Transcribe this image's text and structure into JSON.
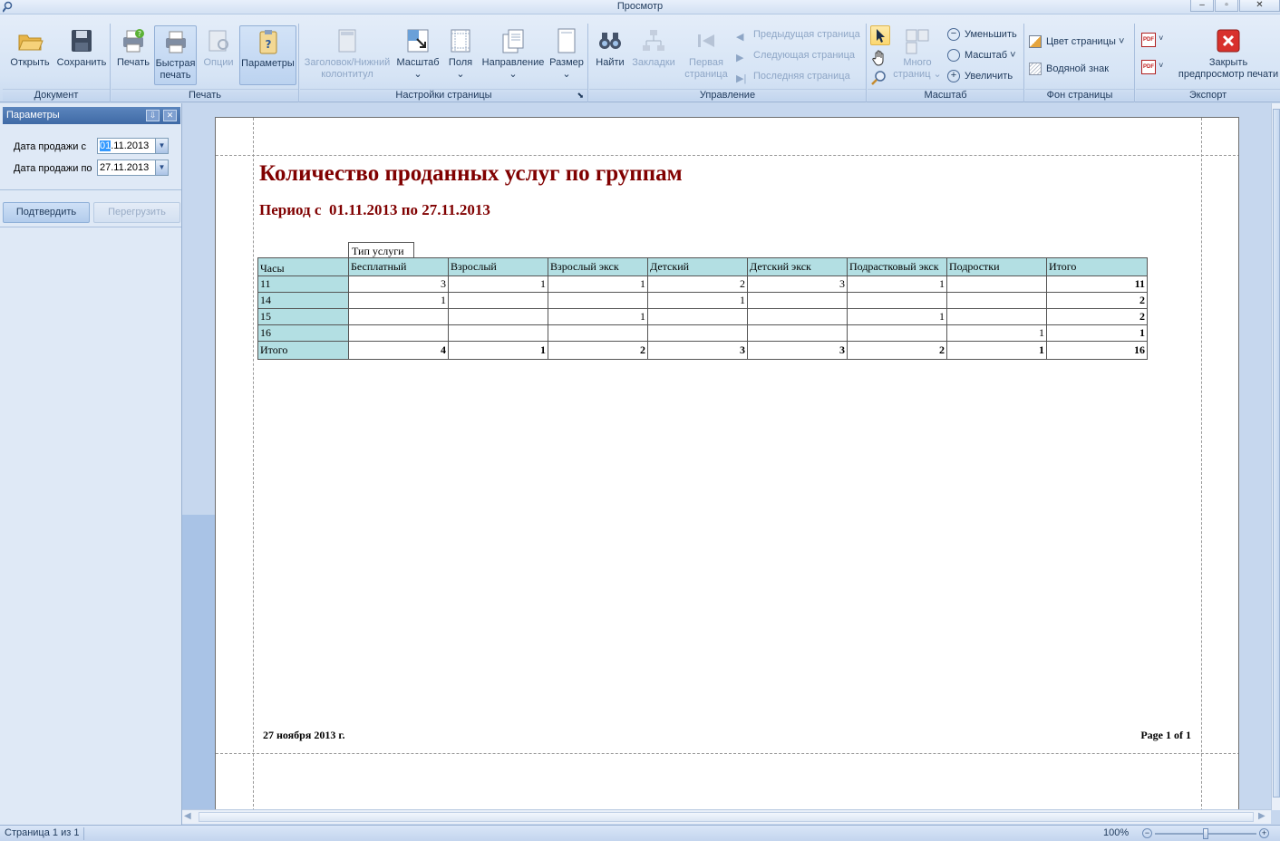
{
  "window": {
    "title": "Просмотр"
  },
  "ribbon": {
    "groups": {
      "document": "Документ",
      "print": "Печать",
      "page_settings": "Настройки страницы",
      "navigation": "Управление",
      "zoom": "Масштаб",
      "background": "Фон страницы",
      "export": "Экспорт"
    },
    "buttons": {
      "open": "Открыть",
      "save": "Сохранить",
      "print": "Печать",
      "quick_print_1": "Быстрая",
      "quick_print_2": "печать",
      "options": "Опции",
      "parameters": "Параметры",
      "header_footer_1": "Заголовок/Нижний",
      "header_footer_2": "колонтитул",
      "scale": "Масштаб",
      "margins": "Поля",
      "orientation": "Направление",
      "size": "Размер",
      "find": "Найти",
      "bookmarks": "Закладки",
      "first_page_1": "Первая",
      "first_page_2": "страница",
      "prev_page": "Предыдущая страница",
      "next_page": "Следующая страница",
      "last_page": "Последняя страница",
      "many_pages_1": "Много",
      "many_pages_2": "страниц",
      "zoom_out": "Уменьшить",
      "zoom": "Масштаб",
      "zoom_in": "Увеличить",
      "page_color": "Цвет страницы",
      "watermark": "Водяной знак",
      "close_1": "Закрыть",
      "close_2": "предпросмотр печати"
    },
    "icons": {
      "pdf": "PDF"
    }
  },
  "parameters_panel": {
    "title": "Параметры",
    "date_from_label": "Дата продажи с",
    "date_from_day": "01",
    "date_from_rest": ".11.2013",
    "date_to_label": "Дата продажи по",
    "date_to_value": "27.11.2013",
    "confirm": "Подтвердить",
    "reload": "Перегрузить"
  },
  "report": {
    "title": "Количество проданных услуг по группам",
    "period_prefix": "Период с",
    "period_from": "01.11.2013",
    "period_sep": "по",
    "period_to": "27.11.2013",
    "service_type_header": "Тип услуги",
    "row_header": "Часы",
    "columns": [
      "Бесплатный",
      "Взрослый",
      "Взрослый экск",
      "Детский",
      "Детский экск",
      "Подрастковый экск",
      "Подростки",
      "Итого"
    ],
    "rows": [
      {
        "hour": "11",
        "values": [
          "3",
          "1",
          "1",
          "2",
          "3",
          "1",
          "",
          "11"
        ]
      },
      {
        "hour": "14",
        "values": [
          "1",
          "",
          "",
          "1",
          "",
          "",
          "",
          "2"
        ]
      },
      {
        "hour": "15",
        "values": [
          "",
          "",
          "1",
          "",
          "",
          "1",
          "",
          "2"
        ]
      },
      {
        "hour": "16",
        "values": [
          "",
          "",
          "",
          "",
          "",
          "",
          "1",
          "1"
        ]
      }
    ],
    "total": {
      "label": "Итого",
      "values": [
        "4",
        "1",
        "2",
        "3",
        "3",
        "2",
        "1",
        "16"
      ]
    },
    "footer_date": "27 ноября 2013 г.",
    "footer_page": "Page 1 of 1"
  },
  "status": {
    "page_info": "Страница 1 из 1",
    "zoom": "100%",
    "zoom_level": 0.5
  }
}
